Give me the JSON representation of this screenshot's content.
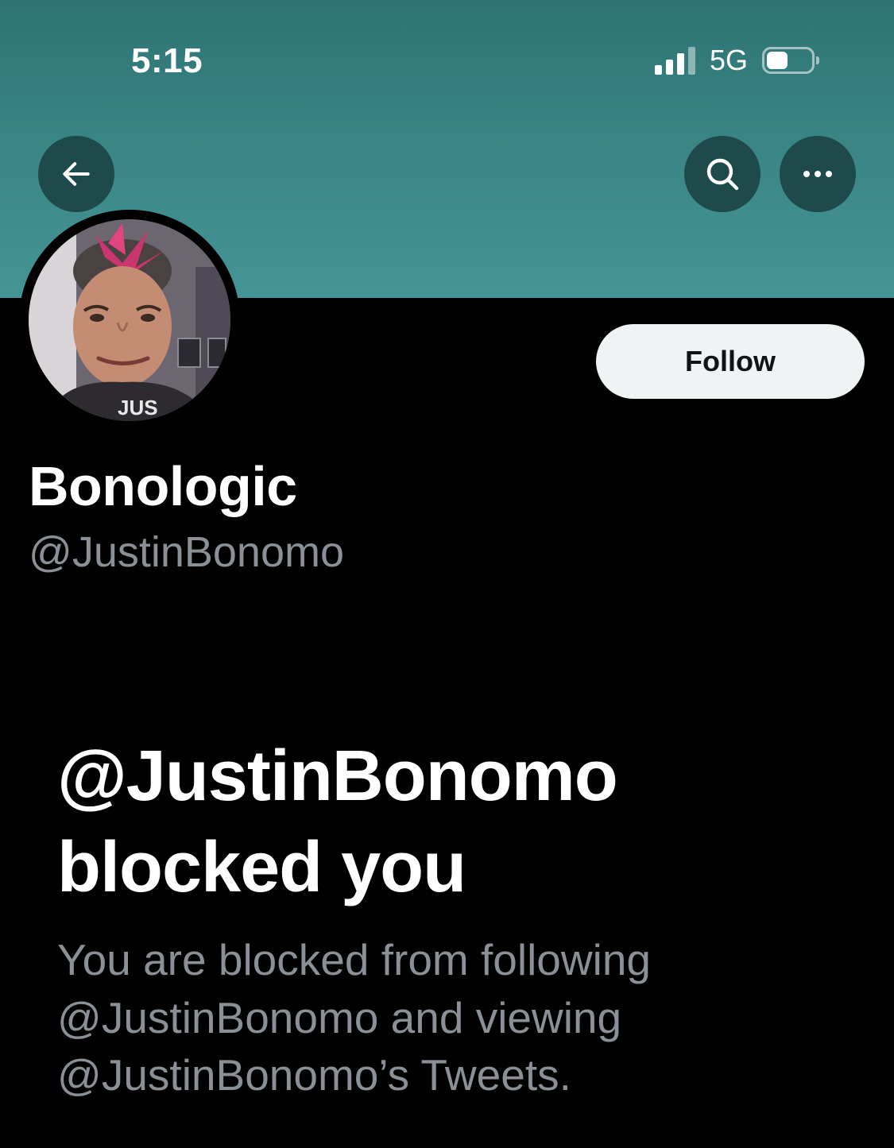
{
  "status_bar": {
    "time": "5:15",
    "network": "5G",
    "signal_bars_active": 3,
    "signal_bars_total": 4,
    "battery_level": 0.4
  },
  "header": {
    "back_icon": "arrow-left-icon",
    "search_icon": "search-icon",
    "more_icon": "more-horizontal-icon",
    "banner_color": "#3a8585"
  },
  "profile": {
    "display_name": "Bonologic",
    "handle": "@JustinBonomo",
    "follow_label": "Follow",
    "avatar_shirt_text": "JUS"
  },
  "blocked": {
    "title_line1": "@JustinBonomo",
    "title_line2": "blocked you",
    "desc_line1": "You are blocked from following",
    "desc_line2": "@JustinBonomo and viewing",
    "desc_line3": "@JustinBonomo’s Tweets."
  }
}
